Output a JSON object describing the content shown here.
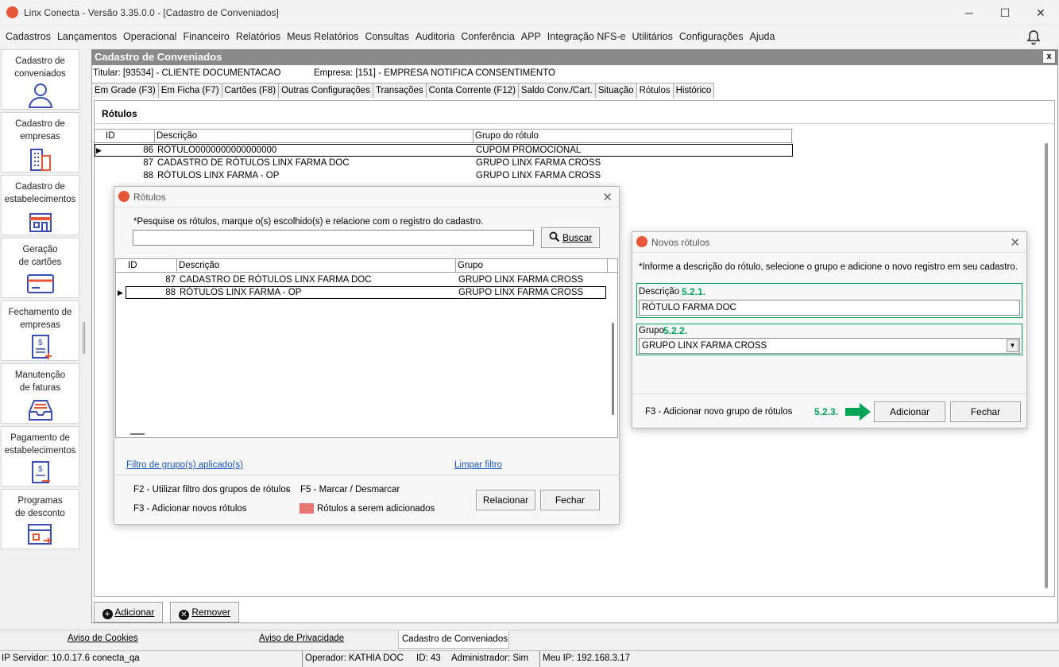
{
  "window": {
    "title": "Linx Conecta - Versão 3.35.0.0 - [Cadastro de Conveniados]",
    "controls": [
      "─",
      "☐",
      "✕"
    ]
  },
  "menu": [
    "Cadastros",
    "Lançamentos",
    "Operacional",
    "Financeiro",
    "Relatórios",
    "Meus Relatórios",
    "Consultas",
    "Auditoria",
    "Conferência",
    "APP",
    "Integração NFS-e",
    "Utilitários",
    "Configurações",
    "Ajuda"
  ],
  "sidebar": [
    {
      "label": "Cadastro de conveniados",
      "icon": "user-icon"
    },
    {
      "label": "Cadastro de empresas",
      "icon": "building-icon"
    },
    {
      "label": "Cadastro de estabelecimentos",
      "icon": "store-icon"
    },
    {
      "label": "Geração de cartões",
      "icon": "card-icon"
    },
    {
      "label": "Fechamento de empresas",
      "icon": "invoice-icon"
    },
    {
      "label": "Manutenção de faturas",
      "icon": "tray-icon"
    },
    {
      "label": "Pagamento de estabelecimentos",
      "icon": "payment-icon"
    },
    {
      "label": "Programas de desconto",
      "icon": "discount-icon"
    }
  ],
  "form": {
    "title": "Cadastro de Conveniados",
    "close": "x",
    "titular": "Titular: [93534] - CLIENTE DOCUMENTACAO",
    "empresa": "Empresa: [151] - EMPRESA NOTIFICA CONSENTIMENTO",
    "tabs": [
      "Em Grade (F3)",
      "Em Ficha (F7)",
      "Cartões (F8)",
      "Outras Configurações",
      "Transações",
      "Conta Corrente (F12)",
      "Saldo Conv./Cart.",
      "Situação",
      "Rótulos",
      "Histórico"
    ],
    "active_tab": "Rótulos",
    "section": "Rótulos",
    "grid_headers": [
      "ID",
      "Descrição",
      "Grupo do rótulo"
    ],
    "grid_rows": [
      {
        "id": "86",
        "desc": "RÓTULO0000000000000000",
        "group": "CUPOM PROMOCIONAL"
      },
      {
        "id": "87",
        "desc": "CADASTRO DE RÓTULOS LINX FARMA DOC",
        "group": "GRUPO LINX  FARMA CROSS"
      },
      {
        "id": "88",
        "desc": "RÓTULOS LINX FARMA - OP",
        "group": "GRUPO LINX  FARMA CROSS"
      }
    ],
    "add_button": "Adicionar",
    "remove_button": "Remover"
  },
  "rotulos_dialog": {
    "title": "Rótulos",
    "hint": "*Pesquise os rótulos, marque o(s) escolhido(s) e relacione com o registro do cadastro.",
    "search_value": "",
    "search_button": "Buscar",
    "headers": [
      "ID",
      "Descrição",
      "Grupo"
    ],
    "rows": [
      {
        "id": "87",
        "desc": "CADASTRO DE RÓTULOS LINX FARMA DOC",
        "group": "GRUPO LINX  FARMA CROSS"
      },
      {
        "id": "88",
        "desc": "RÓTULOS LINX FARMA - OP",
        "group": "GRUPO LINX  FARMA CROSS"
      }
    ],
    "filter_link": "Filtro de grupo(s) aplicado(s)",
    "clear_link": "Limpar filtro",
    "help1": "F2 - Utilizar filtro dos grupos de rótulos",
    "dash": "-",
    "help2": "F5 - Marcar / Desmarcar",
    "help3": "F3 - Adicionar novos rótulos",
    "legend": "Rótulos a serem adicionados",
    "legend_color": "#e97474",
    "relate_button": "Relacionar",
    "close_button": "Fechar"
  },
  "novos_dialog": {
    "title": "Novos rótulos",
    "hint": "*Informe a descrição do rótulo, selecione o grupo e adicione o novo registro em seu cadastro.",
    "desc_label": "Descrição",
    "desc_step": "5.2.1.",
    "desc_value": "RÓTULO FARMA DOC",
    "group_label": "Grupo",
    "group_step": "5.2.2.",
    "group_value": "GRUPO LINX  FARMA CROSS",
    "f3_text": "F3 - Adicionar novo grupo de rótulos",
    "add_step": "5.2.3.",
    "add_button": "Adicionar",
    "close_button": "Fechar",
    "accent": "#00a457"
  },
  "footer": {
    "cookies": "Aviso de Cookies",
    "privacy": "Aviso de Privacidade",
    "tab": "Cadastro de Conveniados"
  },
  "status": {
    "server": "IP Servidor: 10.0.17.6 conecta_qa",
    "operator": "Operador: KATHIA DOC",
    "id": "ID: 43",
    "admin": "Administrador: Sim",
    "myip": "Meu IP: 192.168.3.17"
  }
}
